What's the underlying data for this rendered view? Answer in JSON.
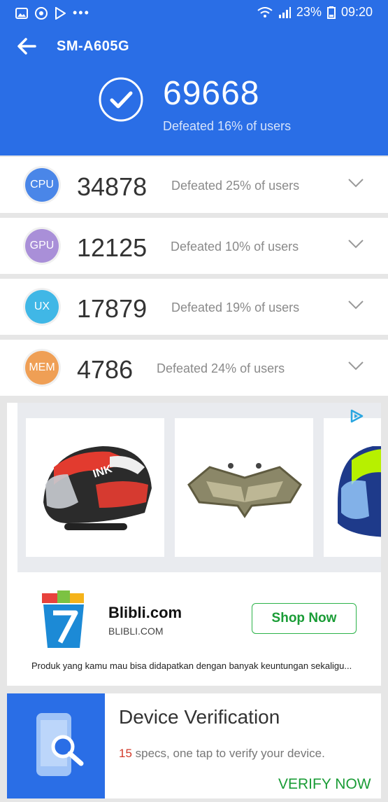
{
  "status_bar": {
    "battery": "23%",
    "time": "09:20",
    "icons": [
      "gallery-icon",
      "chrome-icon",
      "play-store-icon",
      "more-dots-icon",
      "wifi-icon",
      "signal-icon",
      "battery-icon"
    ]
  },
  "header": {
    "title": "SM-A605G",
    "total_score": "69668",
    "total_defeated": "Defeated 16% of users"
  },
  "scores": [
    {
      "label": "CPU",
      "value": "34878",
      "defeated": "Defeated 25% of users",
      "color": "#4a86e8"
    },
    {
      "label": "GPU",
      "value": "12125",
      "defeated": "Defeated 10% of users",
      "color": "#a98fd8"
    },
    {
      "label": "UX",
      "value": "17879",
      "defeated": "Defeated 19% of users",
      "color": "#40b7e6"
    },
    {
      "label": "MEM",
      "value": "4786",
      "defeated": "Defeated 24% of users",
      "color": "#ef9f55"
    }
  ],
  "ad": {
    "brand": "Blibli.com",
    "url": "BLIBLI.COM",
    "cta": "Shop Now",
    "description": "Produk yang kamu mau bisa didapatkan dengan banyak keuntungan sekaligu...",
    "accent": "#2db34a"
  },
  "verification": {
    "title": "Device Verification",
    "count": "15",
    "subtitle": " specs, one tap to verify your device.",
    "cta": "VERIFY NOW"
  }
}
